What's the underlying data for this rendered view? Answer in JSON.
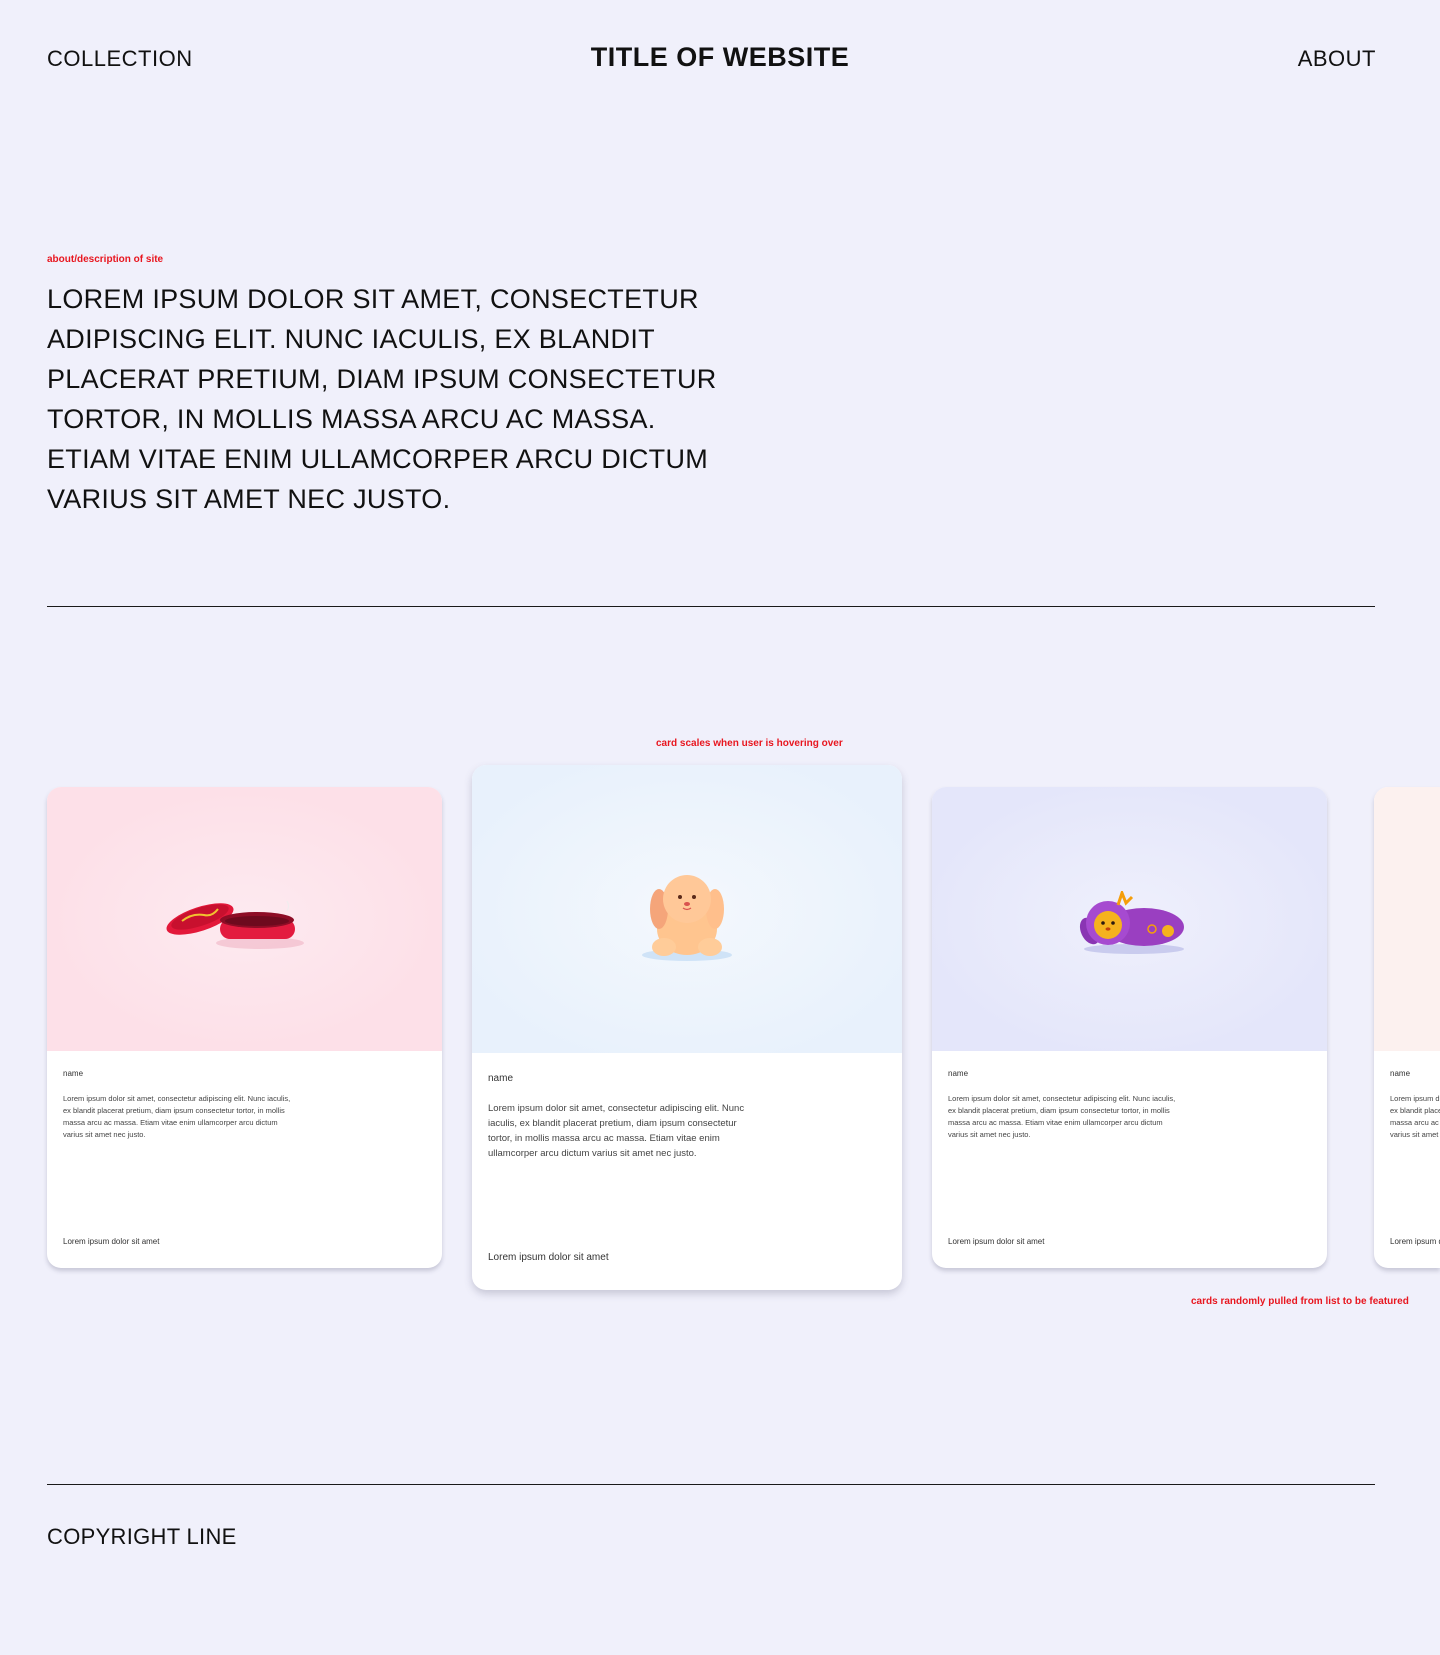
{
  "header": {
    "nav_left": "COLLECTION",
    "title": "TITLE OF WEBSITE",
    "nav_right": "ABOUT"
  },
  "notes": {
    "about": "about/description of site",
    "hover": "card scales when user is hovering over",
    "random": "cards randomly pulled from list to be featured",
    "color": "#e8161f"
  },
  "about": {
    "text": "LOREM IPSUM DOLOR SIT AMET, CONSECTETUR ADIPISCING ELIT. NUNC IACULIS, EX BLANDIT PLACERAT PRETIUM, DIAM IPSUM CONSECTETUR TORTOR, IN MOLLIS MASSA ARCU AC MASSA. ETIAM VITAE ENIM ULLAMCORPER ARCU DICTUM VARIUS SIT AMET NEC JUSTO."
  },
  "cards": [
    {
      "image": "red-tin-box",
      "name": "name",
      "description": "Lorem ipsum dolor sit amet, consectetur adipiscing elit. Nunc iaculis, ex blandit placerat pretium, diam ipsum consectetur tortor, in mollis massa arcu ac massa. Etiam vitae enim ullamcorper arcu dictum varius sit amet nec justo.",
      "footer": "Lorem ipsum dolor sit amet"
    },
    {
      "image": "plush-puppy",
      "name": "name",
      "description": "Lorem ipsum dolor sit amet, consectetur adipiscing elit. Nunc iaculis, ex blandit placerat pretium, diam ipsum consectetur tortor, in mollis massa arcu ac massa. Etiam vitae enim ullamcorper arcu dictum varius sit amet nec justo.",
      "footer": "Lorem ipsum dolor sit amet"
    },
    {
      "image": "purple-plush-toy",
      "name": "name",
      "description": "Lorem ipsum dolor sit amet, consectetur adipiscing elit. Nunc iaculis, ex blandit placerat pretium, diam ipsum consectetur tortor, in mollis massa arcu ac massa. Etiam vitae enim ullamcorper arcu dictum varius sit amet nec justo.",
      "footer": "Lorem ipsum dolor sit amet"
    },
    {
      "image": "peach-image",
      "name": "name",
      "description": "Lorem ipsum dolor sit amet, consectetur adipiscing elit. Nunc iaculis, ex blandit placerat pretium, diam ipsum consectetur tortor, in mollis massa arcu ac massa. Etiam vitae enim ullamcorper arcu dictum varius sit amet nec justo.",
      "footer": "Lorem ipsum dolor sit amet"
    }
  ],
  "footer": {
    "copyright": "COPYRIGHT LINE"
  },
  "colors": {
    "background": "#f0f0fb",
    "card1_bg": "#fde0e8",
    "card2_bg": "#ecf3fc",
    "card3_bg": "#e5e7fa",
    "card4_bg": "#fcf1ef"
  }
}
